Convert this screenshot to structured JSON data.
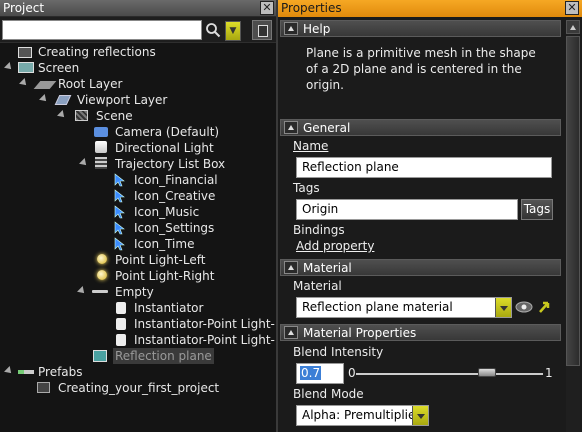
{
  "project_panel": {
    "title": "Project",
    "search": {
      "value": "",
      "placeholder": ""
    },
    "tree": [
      {
        "label": "Creating reflections",
        "icon": "animation-icon"
      },
      {
        "label": "Screen",
        "icon": "screen-icon"
      },
      {
        "label": "Root Layer",
        "icon": "layer-icon"
      },
      {
        "label": "Viewport Layer",
        "icon": "viewport-layer-icon"
      },
      {
        "label": "Scene",
        "icon": "scene-icon"
      },
      {
        "label": "Camera (Default)",
        "icon": "camera-icon"
      },
      {
        "label": "Directional Light",
        "icon": "directional-light-icon"
      },
      {
        "label": "Trajectory List Box",
        "icon": "list-box-icon"
      },
      {
        "label": "Icon_Financial",
        "icon": "component-icon"
      },
      {
        "label": "Icon_Creative",
        "icon": "component-icon"
      },
      {
        "label": "Icon_Music",
        "icon": "component-icon"
      },
      {
        "label": "Icon_Settings",
        "icon": "component-icon"
      },
      {
        "label": "Icon_Time",
        "icon": "component-icon"
      },
      {
        "label": "Point Light-Left",
        "icon": "point-light-icon"
      },
      {
        "label": "Point Light-Right",
        "icon": "point-light-icon"
      },
      {
        "label": "Empty",
        "icon": "empty-node-icon"
      },
      {
        "label": "Instantiator",
        "icon": "instantiator-icon"
      },
      {
        "label": "Instantiator-Point Light-Le",
        "icon": "instantiator-icon"
      },
      {
        "label": "Instantiator-Point Light-Ri",
        "icon": "instantiator-icon"
      },
      {
        "label": "Reflection plane",
        "icon": "plane-icon",
        "selected": true
      },
      {
        "label": "Prefabs",
        "icon": "prefabs-icon"
      },
      {
        "label": "Creating_your_first_project",
        "icon": "project-icon"
      }
    ]
  },
  "properties_panel": {
    "title": "Properties",
    "help": {
      "header": "Help",
      "text": "Plane is a primitive mesh in the shape of a 2D plane and is centered in the origin."
    },
    "general": {
      "header": "General",
      "name_label": "Name",
      "name_value": "Reflection plane",
      "tags_label": "Tags",
      "tags_value": "Origin",
      "tags_button": "Tags",
      "bindings_label": "Bindings",
      "add_property": "Add property"
    },
    "material": {
      "header": "Material",
      "label": "Material",
      "value": "Reflection plane material"
    },
    "material_properties": {
      "header": "Material Properties",
      "blend_intensity_label": "Blend Intensity",
      "blend_intensity_value": "0.7",
      "slider_min": "0",
      "slider_max": "1",
      "slider_level": 0.7,
      "blend_mode_label": "Blend Mode",
      "blend_mode_value": "Alpha: Premultiplied"
    }
  },
  "colors": {
    "properties_title_bg": "#f19a18",
    "dropdown_accent": "#c8c81e"
  }
}
